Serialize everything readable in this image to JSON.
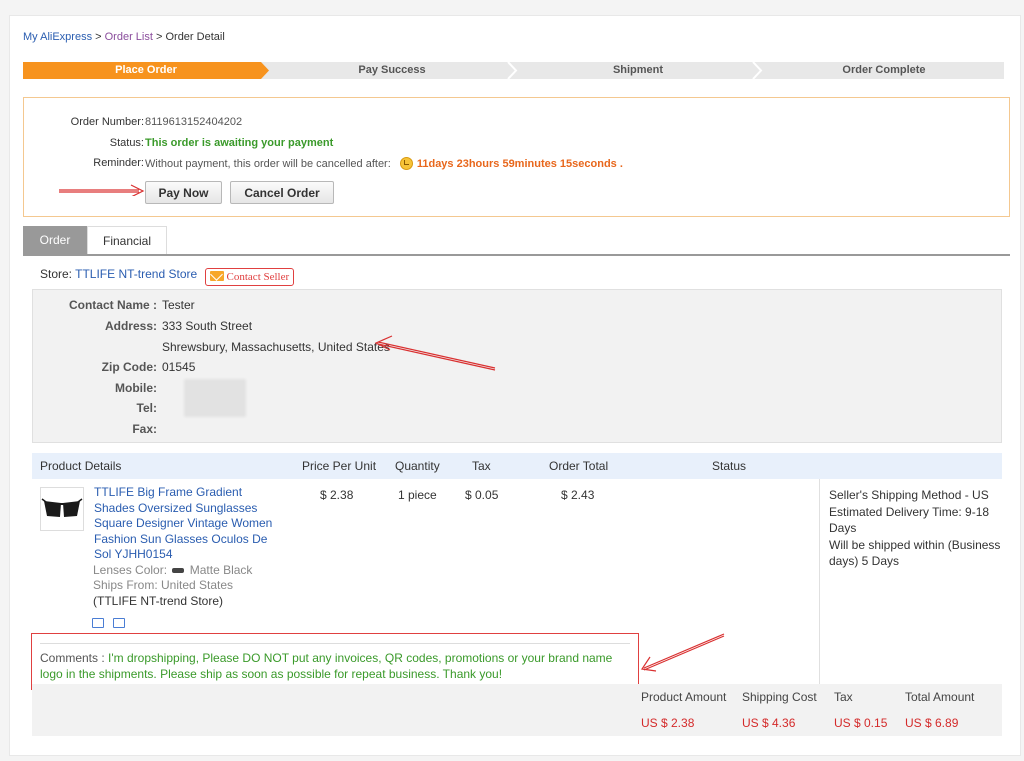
{
  "breadcrumb": {
    "home": "My AliExpress",
    "sep1": " > ",
    "orders": "Order List",
    "sep2": " > ",
    "current": "Order Detail"
  },
  "steps": [
    "Place Order",
    "Pay Success",
    "Shipment",
    "Order Complete"
  ],
  "colors": {
    "active_step": "#f7931e",
    "step_bg": "#e8e8e8",
    "accent_link": "#2a5db0",
    "green": "#3a9a2a",
    "orange": "#e8671c",
    "price_red": "#d42a2a",
    "annotation_red": "#e04040"
  },
  "order": {
    "number_label": "Order Number:",
    "number": "8119613152404202",
    "status_label": "Status:",
    "status": "This order is awaiting your payment",
    "reminder_label": "Reminder:",
    "reminder_text": "Without payment, this order will be cancelled after:",
    "countdown": "11days 23hours 59minutes 15seconds",
    "countdown_suffix": ".",
    "pay_now": "Pay Now",
    "cancel_order": "Cancel Order"
  },
  "tabs": [
    "Order",
    "Financial"
  ],
  "store": {
    "label": "Store:",
    "name": "TTLIFE NT-trend Store",
    "contact": "Contact Seller"
  },
  "address": {
    "contact_name_label": "Contact Name :",
    "contact_name": "Tester",
    "address_label": "Address:",
    "address_line1": "333 South Street",
    "address_line2": "Shrewsbury, Massachusetts, United States",
    "zip_label": "Zip Code:",
    "zip": "01545",
    "mobile_label": "Mobile:",
    "tel_label": "Tel:",
    "fax_label": "Fax:"
  },
  "table": {
    "headers": [
      "Product Details",
      "Price Per Unit",
      "Quantity",
      "Tax",
      "Order Total",
      "Status"
    ],
    "product": {
      "title": "TTLIFE Big Frame Gradient Shades Oversized Sunglasses Square Designer Vintage Women Fashion Sun Glasses Oculos De Sol YJHH0154",
      "lens_label": "Lenses Color:",
      "lens_value": "Matte Black",
      "ships_from": "Ships From: United States",
      "store_ref": "(TTLIFE NT-trend Store)",
      "price": "$ 2.38",
      "quantity": "1 piece",
      "tax": "$ 0.05",
      "total": "$ 2.43"
    },
    "shipping": {
      "method": "Seller's Shipping Method - US",
      "estimated": "Estimated Delivery Time: 9-18 Days",
      "within": "Will be shipped within (Business days) 5 Days"
    }
  },
  "comments": {
    "label": "Comments :",
    "text": "I'm dropshipping, Please DO NOT put any invoices, QR codes, promotions or your brand name logo in the shipments. Please ship as soon as possible for repeat business. Thank you!"
  },
  "summary": {
    "labels": [
      "Product Amount",
      "Shipping Cost",
      "Tax",
      "Total Amount"
    ],
    "values": [
      "US $ 2.38",
      "US $ 4.36",
      "US $ 0.15",
      "US $ 6.89"
    ]
  },
  "icons": {
    "pay_arrow": "arrow-right-icon",
    "clock": "clock-icon",
    "mail": "envelope-icon",
    "truck": "truck-icon",
    "card": "card-icon"
  }
}
